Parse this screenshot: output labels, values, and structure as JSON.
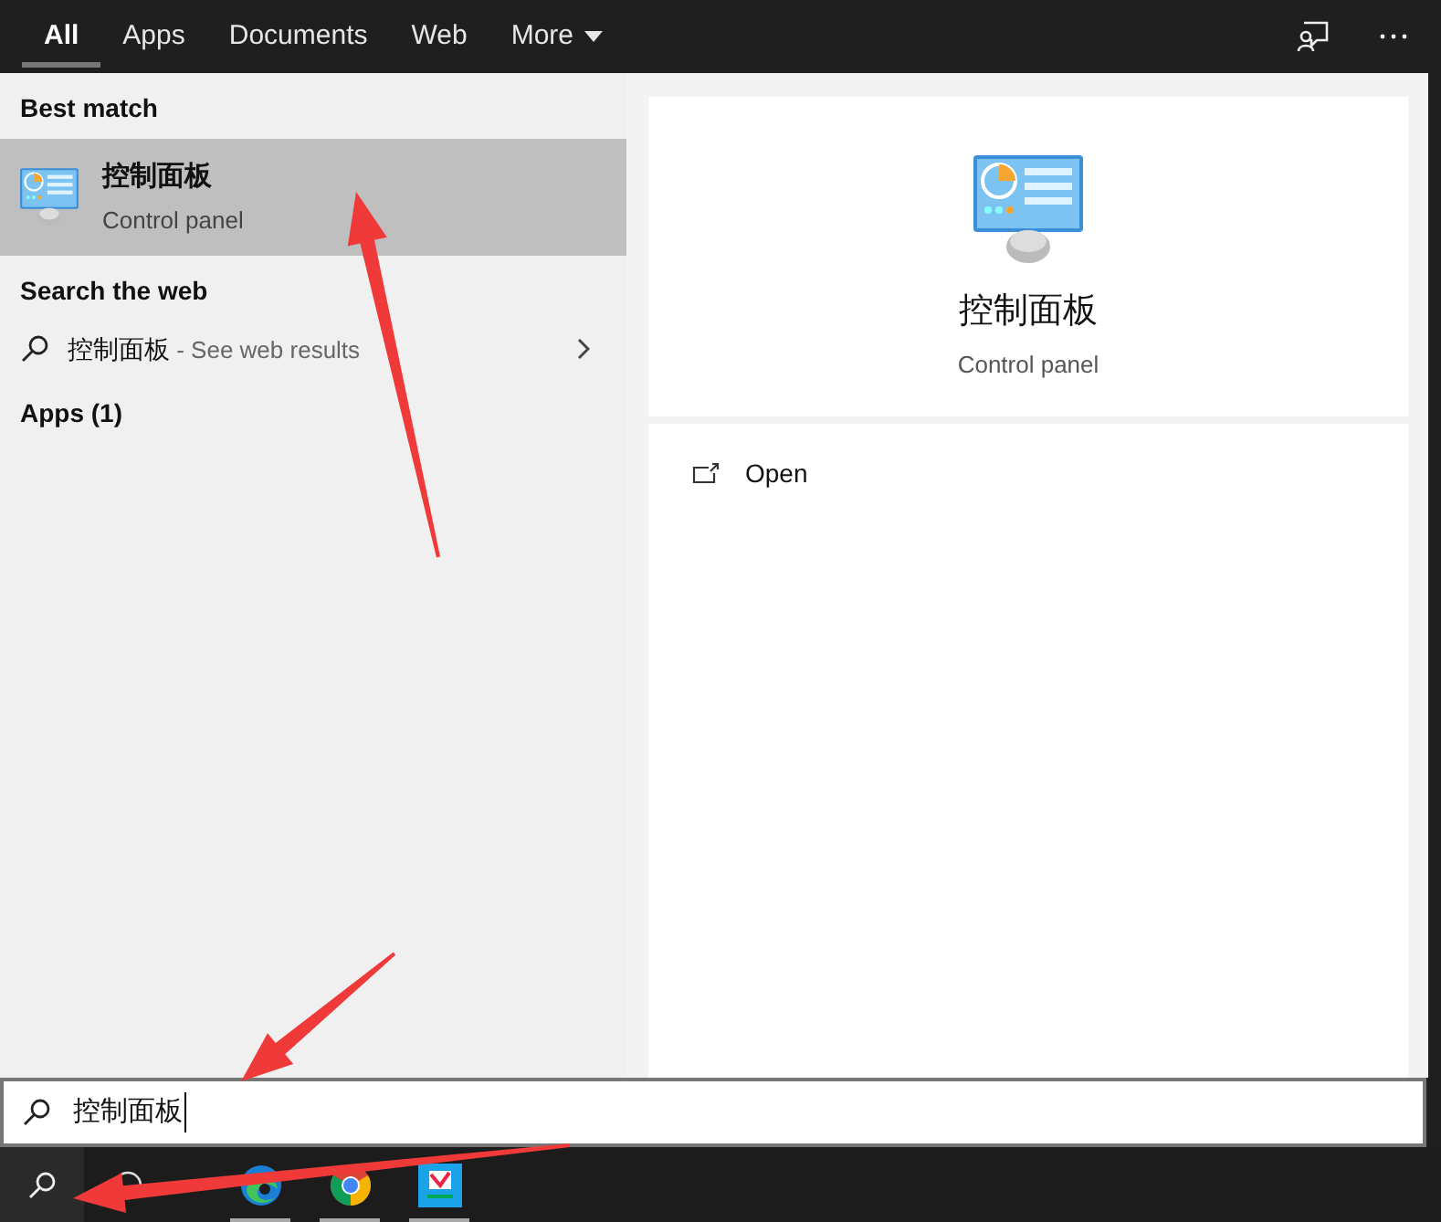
{
  "tabs": [
    {
      "label": "All",
      "selected": true
    },
    {
      "label": "Apps",
      "selected": false
    },
    {
      "label": "Documents",
      "selected": false
    },
    {
      "label": "Web",
      "selected": false
    },
    {
      "label": "More",
      "selected": false,
      "kind": "dropdown"
    }
  ],
  "best_match": {
    "heading": "Best match",
    "title": "控制面板",
    "subtitle": "Control panel",
    "selected": true
  },
  "search_the_web": {
    "heading": "Search the web",
    "query": "控制面板",
    "suffix": " - See web results"
  },
  "apps_heading": "Apps (1)",
  "detail": {
    "title": "控制面板",
    "subtitle": "Control panel",
    "actions": [
      {
        "label": "Open"
      }
    ]
  },
  "search": {
    "value": "控制面板"
  },
  "taskbar": {
    "apps": [
      {
        "kind": "edge",
        "running": true
      },
      {
        "kind": "chrome",
        "running": true
      },
      {
        "kind": "app",
        "running": true
      }
    ]
  }
}
